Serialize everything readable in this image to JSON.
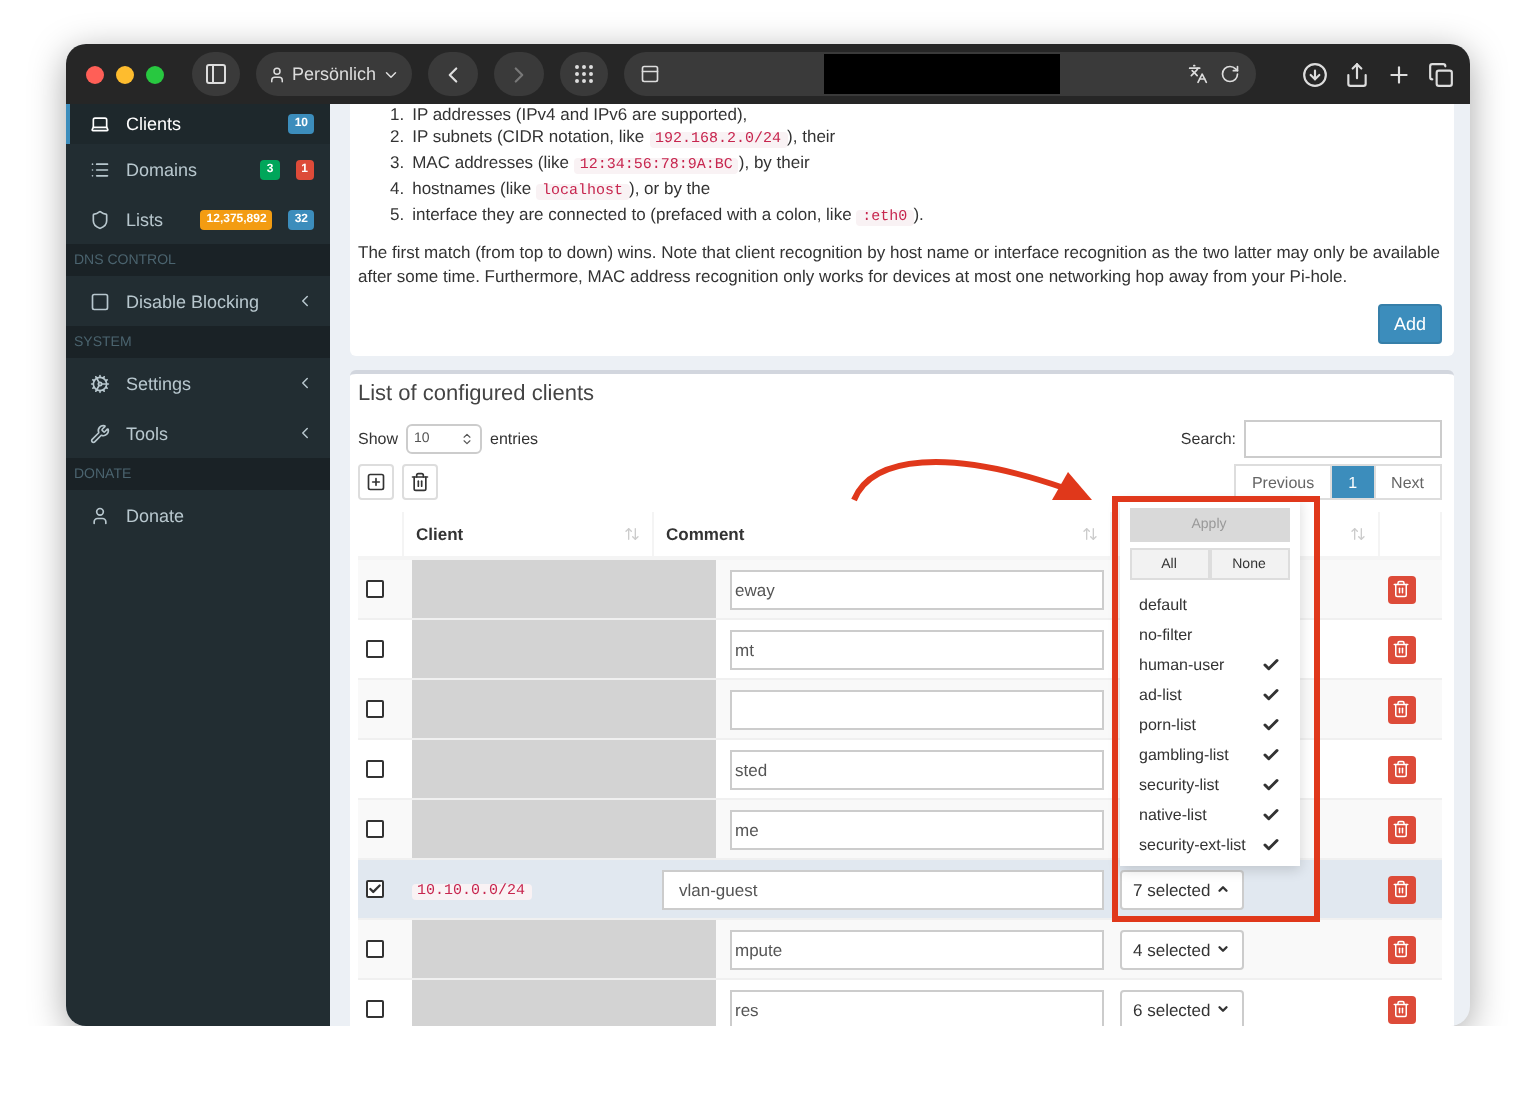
{
  "browser": {
    "profile": "Persönlich"
  },
  "sidebar": {
    "sections": [
      {
        "items": [
          {
            "label": "Clients",
            "selected": true,
            "expandable": false,
            "badges": [
              {
                "text": "10",
                "color": "#3c8dbc"
              }
            ]
          },
          {
            "label": "Domains",
            "selected": false,
            "expandable": false,
            "badges": [
              {
                "text": "3",
                "color": "#00a65a"
              },
              {
                "text": "1",
                "color": "#dd4b39"
              }
            ]
          },
          {
            "label": "Lists",
            "selected": false,
            "expandable": false,
            "badges": [
              {
                "text": "12,375,892",
                "color": "#f39c12"
              },
              {
                "text": "32",
                "color": "#3c8dbc"
              }
            ]
          }
        ]
      },
      {
        "header": "DNS CONTROL",
        "items": [
          {
            "label": "Disable Blocking",
            "selected": false,
            "expandable": true
          }
        ]
      },
      {
        "header": "SYSTEM",
        "items": [
          {
            "label": "Settings",
            "selected": false,
            "expandable": true
          },
          {
            "label": "Tools",
            "selected": false,
            "expandable": true
          }
        ]
      },
      {
        "header": "DONATE",
        "items": [
          {
            "label": "Donate",
            "selected": false,
            "expandable": false
          }
        ]
      }
    ]
  },
  "info_card": {
    "list": [
      {
        "number": "1.",
        "parts": [
          {
            "kind": "text",
            "text": "IP addresses (IPv4 and IPv6 are supported),"
          }
        ]
      },
      {
        "number": "2.",
        "parts": [
          {
            "kind": "text",
            "text": "IP subnets (CIDR notation, like "
          },
          {
            "kind": "code",
            "text": "192.168.2.0/24"
          },
          {
            "kind": "text",
            "text": "), their"
          }
        ]
      },
      {
        "number": "3.",
        "parts": [
          {
            "kind": "text",
            "text": "MAC addresses (like "
          },
          {
            "kind": "code",
            "text": "12:34:56:78:9A:BC"
          },
          {
            "kind": "text",
            "text": "), by their"
          }
        ]
      },
      {
        "number": "4.",
        "parts": [
          {
            "kind": "text",
            "text": "hostnames (like "
          },
          {
            "kind": "code",
            "text": "localhost"
          },
          {
            "kind": "text",
            "text": "), or by the"
          }
        ]
      },
      {
        "number": "5.",
        "parts": [
          {
            "kind": "text",
            "text": "interface they are connected to (prefaced with a colon, like "
          },
          {
            "kind": "code",
            "text": ":eth0"
          },
          {
            "kind": "text",
            "text": ")."
          }
        ]
      }
    ],
    "note": "The first match (from top to down) wins. Note that client recognition by host name or interface recognition as the two latter may only be available after some time. Furthermore, MAC address recognition only works for devices at most one networking hop away from your Pi-hole.",
    "add_button": "Add"
  },
  "clients_card": {
    "title": "List of configured clients",
    "show_label": "Show",
    "page_size": "10",
    "entries_label": "entries",
    "search_label": "Search:",
    "pagination": {
      "previous": "Previous",
      "pages": [
        {
          "label": "1",
          "selected": true
        }
      ],
      "next": "Next"
    },
    "columns": [
      "Client",
      "Comment"
    ],
    "rows": [
      {
        "selected": false,
        "redacted": true,
        "comment": "eway"
      },
      {
        "selected": false,
        "redacted": true,
        "comment": "mt"
      },
      {
        "selected": false,
        "redacted": true
      },
      {
        "selected": false,
        "redacted": true,
        "comment": "sted"
      },
      {
        "selected": false,
        "redacted": true,
        "comment": "me"
      },
      {
        "selected": true,
        "redacted": false,
        "client": "10.10.0.0/24",
        "comment": "vlan-guest",
        "groups": "7 selected",
        "menu_open": true
      },
      {
        "selected": false,
        "redacted": true,
        "comment": "mpute",
        "groups": "4 selected",
        "menu_open": false
      },
      {
        "selected": false,
        "redacted": true,
        "comment": "res",
        "groups": "6 selected",
        "menu_open": false
      }
    ],
    "group_menu": {
      "apply": "Apply",
      "apply_disabled": true,
      "all": "All",
      "none": "None",
      "options": [
        {
          "label": "default",
          "checked": false
        },
        {
          "label": "no-filter",
          "checked": false
        },
        {
          "label": "human-user",
          "checked": true
        },
        {
          "label": "ad-list",
          "checked": true
        },
        {
          "label": "porn-list",
          "checked": true
        },
        {
          "label": "gambling-list",
          "checked": true
        },
        {
          "label": "security-list",
          "checked": true
        },
        {
          "label": "native-list",
          "checked": true
        },
        {
          "label": "security-ext-list",
          "checked": true
        }
      ]
    }
  }
}
